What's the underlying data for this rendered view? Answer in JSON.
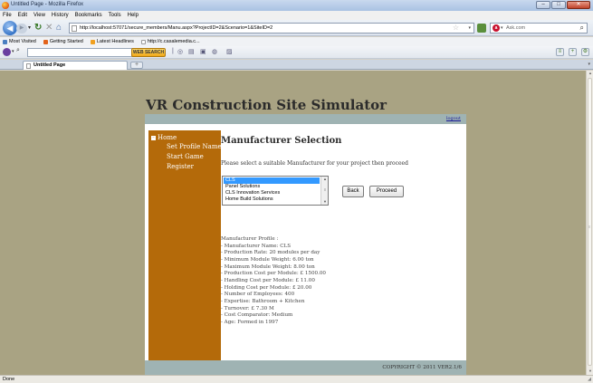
{
  "window": {
    "title": "Untitled Page - Mozilla Firefox",
    "buttons": [
      "–",
      "□",
      "✕"
    ]
  },
  "menubar": [
    "File",
    "Edit",
    "View",
    "History",
    "Bookmarks",
    "Tools",
    "Help"
  ],
  "navbar": {
    "url": "http://localhost:57071/secure_members/Manu.aspx?ProjectID=2&Scenario=1&SiteID=2",
    "search_engine_placeholder": "Ask.com"
  },
  "bookmarks": [
    "Most Visited",
    "Getting Started",
    "Latest Headlines",
    "http://c.casalemedia.c..."
  ],
  "search_toolbar": {
    "button_label": "WEB SEARCH"
  },
  "tabs": [
    {
      "label": "Untitled Page"
    }
  ],
  "page": {
    "site_title": "VR Construction Site Simulator",
    "logout": "logout",
    "sidebar": {
      "home": "Home",
      "items": [
        "Set Profile Name",
        "Start Game",
        "Register"
      ]
    },
    "heading": "Manufacturer Selection",
    "instruction": "Please select a suitable Manufacturer for your project then proceed",
    "manufacturers": {
      "options": [
        "CLS",
        "Panel Solutions",
        "CLS Innovation Services",
        "Home Build Solutions"
      ],
      "selected": "CLS"
    },
    "back_label": "Back",
    "proceed_label": "Proceed",
    "profile": [
      "Manufacturer Profile :",
      "- Manufacturer Name: CLS",
      "- Production Rate: 20 modules per day",
      "- Minimum Module Weight: 6.00 ton",
      "- Maximum Module Weight: 8.00 ton",
      "- Production Cost per Module: £ 1500.00",
      "- Handling Cost per Module: £ 11.00",
      "- Holding Cost per Module: £ 20.00",
      "- Number of Employees: 400",
      "- Expertise: Bathroom + Kitchen",
      "- Turnover: £ 7.30 M",
      "- Cost Comparator: Medium",
      "- Age: Formed in 1997"
    ],
    "footer": "COPYRIGHT © 2011 VER2.1/6"
  },
  "status": "Done",
  "colors": {
    "page_background": "#a9a383",
    "sidebar": "#b46a0a",
    "band": "#9fb3b3",
    "selection": "#3399ff"
  }
}
